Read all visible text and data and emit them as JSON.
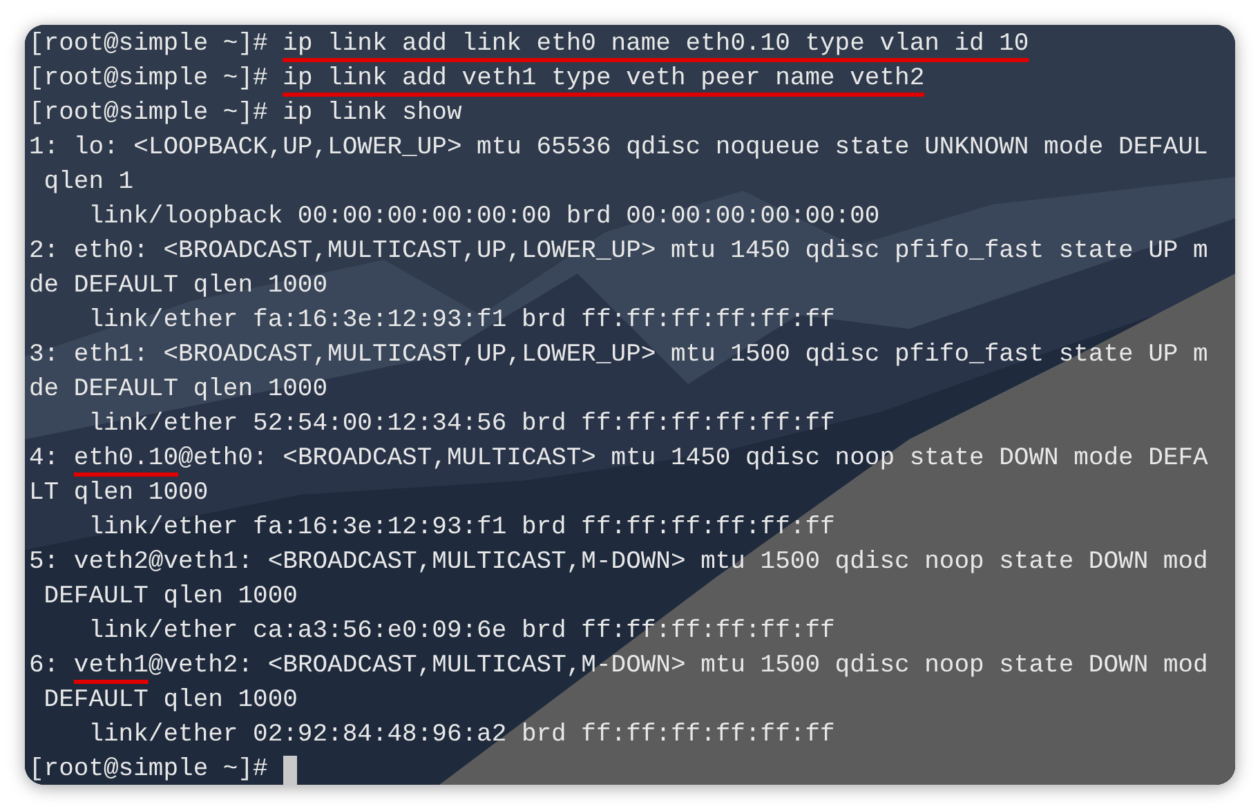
{
  "terminal": {
    "lines": [
      {
        "segments": [
          {
            "text": "[root@simple ~]# ",
            "underlined": false
          },
          {
            "text": "ip link add link eth0 name eth0.10 type vlan id 10",
            "underlined": true
          }
        ]
      },
      {
        "segments": [
          {
            "text": "[root@simple ~]# ",
            "underlined": false
          },
          {
            "text": "ip link add veth1 type veth peer name veth2",
            "underlined": true
          }
        ]
      },
      {
        "segments": [
          {
            "text": "[root@simple ~]# ip link show",
            "underlined": false
          }
        ]
      },
      {
        "segments": [
          {
            "text": "1: lo: <LOOPBACK,UP,LOWER_UP> mtu 65536 qdisc noqueue state UNKNOWN mode DEFAUL",
            "underlined": false
          }
        ]
      },
      {
        "segments": [
          {
            "text": " qlen 1",
            "underlined": false
          }
        ]
      },
      {
        "segments": [
          {
            "text": "    link/loopback 00:00:00:00:00:00 brd 00:00:00:00:00:00",
            "underlined": false
          }
        ]
      },
      {
        "segments": [
          {
            "text": "2: eth0: <BROADCAST,MULTICAST,UP,LOWER_UP> mtu 1450 qdisc pfifo_fast state UP m",
            "underlined": false
          }
        ]
      },
      {
        "segments": [
          {
            "text": "de DEFAULT qlen 1000",
            "underlined": false
          }
        ]
      },
      {
        "segments": [
          {
            "text": "    link/ether fa:16:3e:12:93:f1 brd ff:ff:ff:ff:ff:ff",
            "underlined": false
          }
        ]
      },
      {
        "segments": [
          {
            "text": "3: eth1: <BROADCAST,MULTICAST,UP,LOWER_UP> mtu 1500 qdisc pfifo_fast state UP m",
            "underlined": false
          }
        ]
      },
      {
        "segments": [
          {
            "text": "de DEFAULT qlen 1000",
            "underlined": false
          }
        ]
      },
      {
        "segments": [
          {
            "text": "    link/ether 52:54:00:12:34:56 brd ff:ff:ff:ff:ff:ff",
            "underlined": false
          }
        ]
      },
      {
        "segments": [
          {
            "text": "4: ",
            "underlined": false
          },
          {
            "text": "eth0.10",
            "underlined": true
          },
          {
            "text": "@eth0: <BROADCAST,MULTICAST> mtu 1450 qdisc noop state DOWN mode DEFA",
            "underlined": false
          }
        ]
      },
      {
        "segments": [
          {
            "text": "LT qlen 1000",
            "underlined": false
          }
        ]
      },
      {
        "segments": [
          {
            "text": "    link/ether fa:16:3e:12:93:f1 brd ff:ff:ff:ff:ff:ff",
            "underlined": false
          }
        ]
      },
      {
        "segments": [
          {
            "text": "5: veth2@veth1: <BROADCAST,MULTICAST,M-DOWN> mtu 1500 qdisc noop state DOWN mod",
            "underlined": false
          }
        ]
      },
      {
        "segments": [
          {
            "text": " DEFAULT qlen 1000",
            "underlined": false
          }
        ]
      },
      {
        "segments": [
          {
            "text": "    link/ether ca:a3:56:e0:09:6e brd ff:ff:ff:ff:ff:ff",
            "underlined": false
          }
        ]
      },
      {
        "segments": [
          {
            "text": "6: ",
            "underlined": false
          },
          {
            "text": "veth1",
            "underlined": true
          },
          {
            "text": "@veth2: <BROADCAST,MULTICAST,M-DOWN> mtu 1500 qdisc noop state DOWN mod",
            "underlined": false
          }
        ]
      },
      {
        "segments": [
          {
            "text": " DEFAULT qlen 1000",
            "underlined": false
          }
        ]
      },
      {
        "segments": [
          {
            "text": "    link/ether 02:92:84:48:96:a2 brd ff:ff:ff:ff:ff:ff",
            "underlined": false
          }
        ]
      },
      {
        "segments": [
          {
            "text": "[root@simple ~]# ",
            "underlined": false
          }
        ],
        "cursor": true
      }
    ]
  }
}
